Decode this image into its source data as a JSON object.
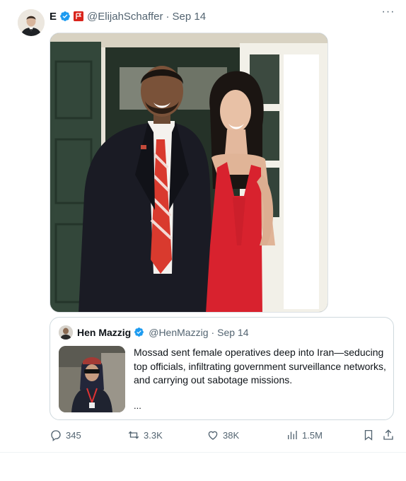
{
  "author": {
    "name": "E",
    "handle": "@ElijahSchaffer",
    "separator": "·",
    "date": "Sep 14"
  },
  "quoted": {
    "name": "Hen Mazzig",
    "handle": "@HenMazzig",
    "separator": "·",
    "date": "Sep 14",
    "text": "Mossad sent female operatives deep into Iran—seducing top officials, infiltrating government surveillance networks, and carrying out sabotage missions.",
    "ellipsis": "..."
  },
  "actions": {
    "replies": "345",
    "reposts": "3.3K",
    "likes": "38K",
    "views": "1.5M"
  },
  "menu": {
    "more": "···"
  },
  "colors": {
    "verified": "#1d9bf0",
    "muted": "#536471",
    "flag": "#d9251c"
  },
  "icons": [
    "verified-icon",
    "flag-badge-icon",
    "more-icon",
    "reply-icon",
    "repost-icon",
    "like-icon",
    "views-icon",
    "bookmark-icon",
    "share-icon"
  ]
}
